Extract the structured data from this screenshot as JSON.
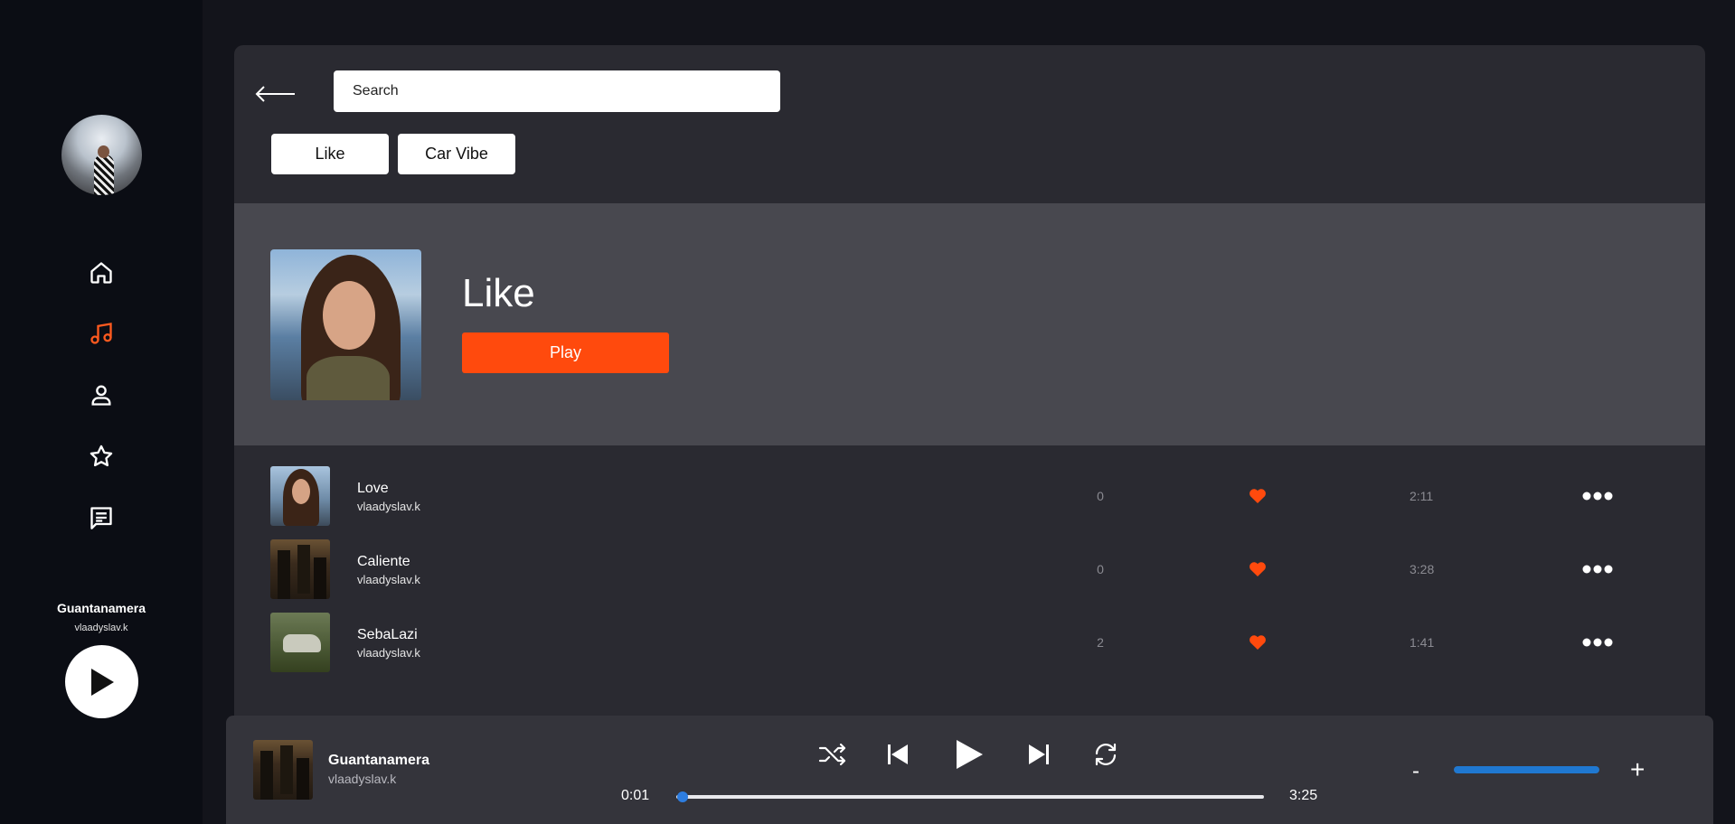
{
  "sidebar": {
    "now_playing": {
      "title": "Guantanamera",
      "artist": "vlaadyslav.k"
    }
  },
  "search": {
    "placeholder": "Search"
  },
  "chips": [
    "Like",
    "Car Vibe"
  ],
  "playlist": {
    "title": "Like",
    "play_label": "Play"
  },
  "tracks": [
    {
      "title": "Love",
      "artist": "vlaadyslav.k",
      "count": "0",
      "duration": "2:11"
    },
    {
      "title": "Caliente",
      "artist": "vlaadyslav.k",
      "count": "0",
      "duration": "3:28"
    },
    {
      "title": "SebaLazi",
      "artist": "vlaadyslav.k",
      "count": "2",
      "duration": "1:41"
    }
  ],
  "player": {
    "title": "Guantanamera",
    "artist": "vlaadyslav.k",
    "elapsed": "0:01",
    "total": "3:25",
    "progress": 0.01,
    "volume": 1.0,
    "volume_minus": "-",
    "volume_plus": "+"
  },
  "colors": {
    "accent": "#ff4a0d",
    "active_nav": "#ff5a1f",
    "progress": "#2d7de0",
    "volume": "#1f78d1"
  }
}
